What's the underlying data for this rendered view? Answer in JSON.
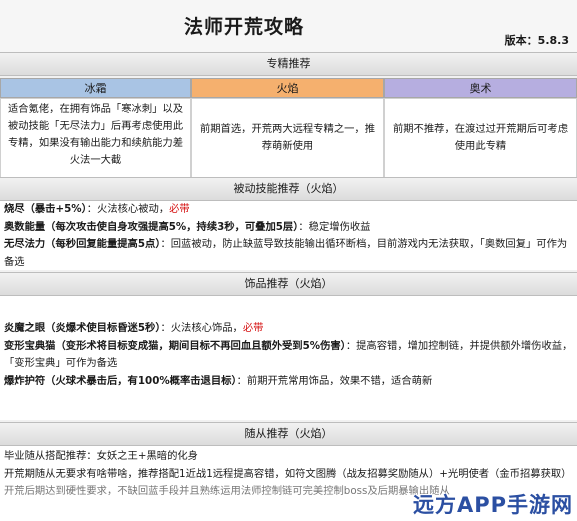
{
  "title": "法师开荒攻略",
  "version": "版本：5.8.3",
  "specialization": {
    "header": "专精推荐",
    "tabs": [
      "冰霜",
      "火焰",
      "奥术"
    ],
    "descriptions": [
      "适合氪佬，在拥有饰品「寒冰刺」以及被动技能「无尽法力」后再考虑使用此专精，如果没有输出能力和续航能力差火法一大截",
      "前期首选，开荒两大远程专精之一，推荐萌新使用",
      "前期不推荐，在渡过过开荒期后可考虑使用此专精"
    ]
  },
  "passive": {
    "header": "被动技能推荐（火焰）",
    "items": [
      {
        "name": "烧尽（暴击+5%）",
        "desc": "：火法核心被动，",
        "tag": "必带"
      },
      {
        "name": "奥数能量（每次攻击使自身攻强提高5%，持续3秒，可叠加5层）",
        "desc": "：稳定增伤收益",
        "tag": ""
      },
      {
        "name": "无尽法力（每秒回复能量提高5点）",
        "desc": "：回蓝被动，防止缺蓝导致技能输出循环断档，目前游戏内无法获取，「奥数回复」可作为备选",
        "tag": ""
      }
    ]
  },
  "accessory": {
    "header": "饰品推荐（火焰）",
    "items": [
      {
        "name": "炎魔之眼（炎爆术使目标昏迷5秒）",
        "desc": "：火法核心饰品，",
        "tag": "必带"
      },
      {
        "name": "变形宝典猫（变形术将目标变成猫，期间目标不再回血且额外受到5%伤害）",
        "desc": "：提高容错，增加控制链，并提供额外增伤收益，「变形宝典」可作为备选",
        "tag": ""
      },
      {
        "name": "爆炸护符（火球术暴击后，有100%概率击退目标）",
        "desc": "：前期开荒常用饰品，效果不错，适合萌新",
        "tag": ""
      }
    ]
  },
  "companion": {
    "header": "随从推荐（火焰）",
    "lines": [
      "毕业随从搭配推荐：女妖之王+黑暗的化身",
      "开荒期随从无要求有啥带啥，推荐搭配1近战1远程提高容错，如符文图腾（战友招募奖励随从）+光明使者（金币招募获取）",
      "开荒后期达到硬性要求，不缺回蓝手段并且熟练运用法师控制链可完美控制boss及后期暴输出随从"
    ]
  },
  "watermark": "远方APP手游网"
}
